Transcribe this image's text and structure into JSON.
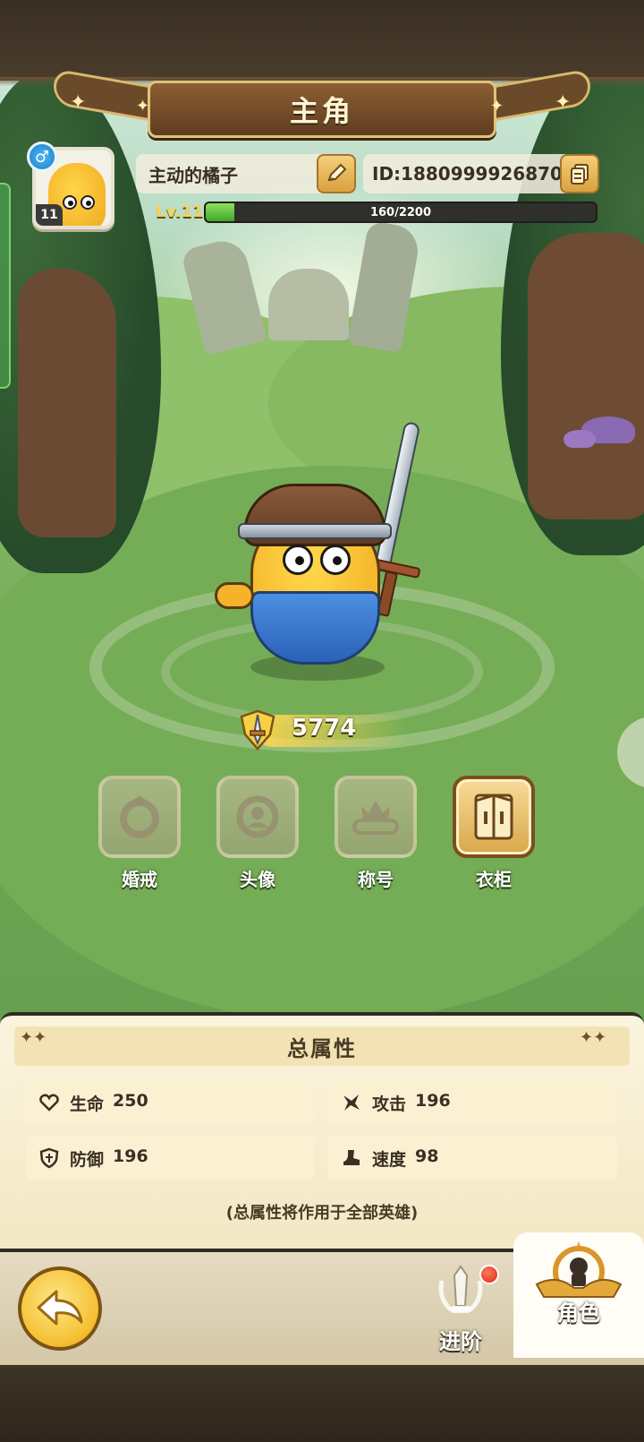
{
  "header": {
    "title": "主角"
  },
  "profile": {
    "avatar_level": "11",
    "gender_symbol": "♂",
    "name": "主动的橘子",
    "id_text": "ID:1880999926870",
    "level_label": "Lv.11",
    "xp_text": "160/2200",
    "xp_fraction": 0.073
  },
  "power": {
    "value": "5774"
  },
  "features": [
    {
      "label": "婚戒",
      "icon": "ring-icon",
      "active": false
    },
    {
      "label": "头像",
      "icon": "avatar-frame-icon",
      "active": false
    },
    {
      "label": "称号",
      "icon": "title-crown-icon",
      "active": false
    },
    {
      "label": "衣柜",
      "icon": "wardrobe-icon",
      "active": true
    }
  ],
  "stats": {
    "title": "总属性",
    "items": [
      {
        "label": "生命",
        "value": "250",
        "icon": "heart-icon"
      },
      {
        "label": "攻击",
        "value": "196",
        "icon": "attack-icon"
      },
      {
        "label": "防御",
        "value": "196",
        "icon": "shield-icon"
      },
      {
        "label": "速度",
        "value": "98",
        "icon": "boot-icon"
      }
    ],
    "note": "(总属性将作用于全部英雄)"
  },
  "bottom_nav": {
    "back_icon": "back-arrow-icon",
    "tabs": [
      {
        "label": "进阶",
        "icon": "sword-upgrade-icon",
        "active": false,
        "has_notification": true
      },
      {
        "label": "角色",
        "icon": "character-icon",
        "active": true,
        "has_notification": false
      }
    ]
  },
  "colors": {
    "accent_gold": "#f4be2f",
    "xp_green": "#3fa52c",
    "panel_cream": "#fbf4de",
    "notification_red": "#e02812"
  }
}
